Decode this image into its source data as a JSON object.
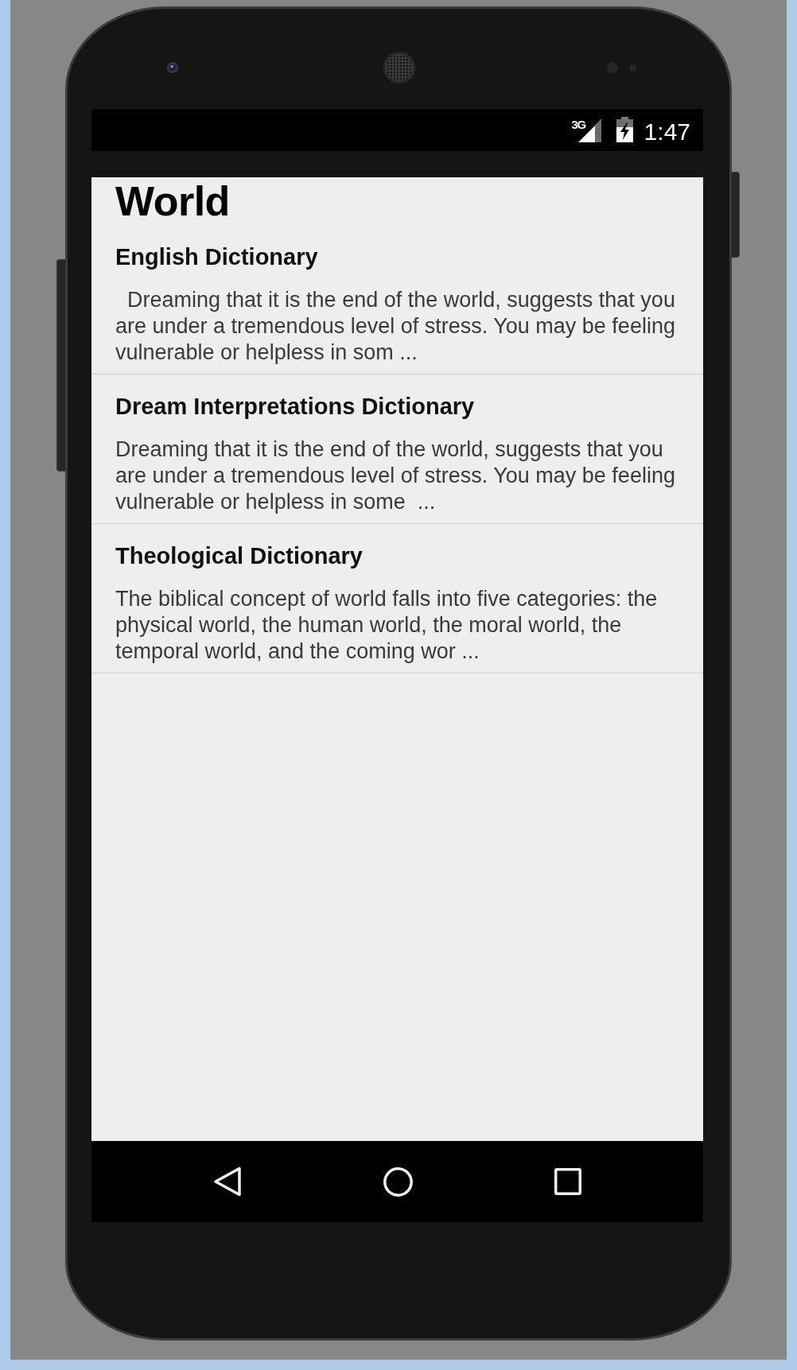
{
  "status_bar": {
    "network": "3G",
    "time": "1:47"
  },
  "app": {
    "title": "World",
    "entries": [
      {
        "title": "English Dictionary",
        "snippet": "  Dreaming that it is the end of the world, suggests that you are under a tremendous level of stress. You may be feeling vulnerable or helpless in som ..."
      },
      {
        "title": "Dream Interpretations Dictionary",
        "snippet": "Dreaming that it is the end of the world, suggests that you are under a tremendous level of stress. You may be feeling vulnerable or helpless in some  ..."
      },
      {
        "title": "Theological Dictionary",
        "snippet": "The biblical concept of world falls into five categories: the physical world, the human world, the moral world, the temporal world, and the coming wor ..."
      }
    ]
  }
}
